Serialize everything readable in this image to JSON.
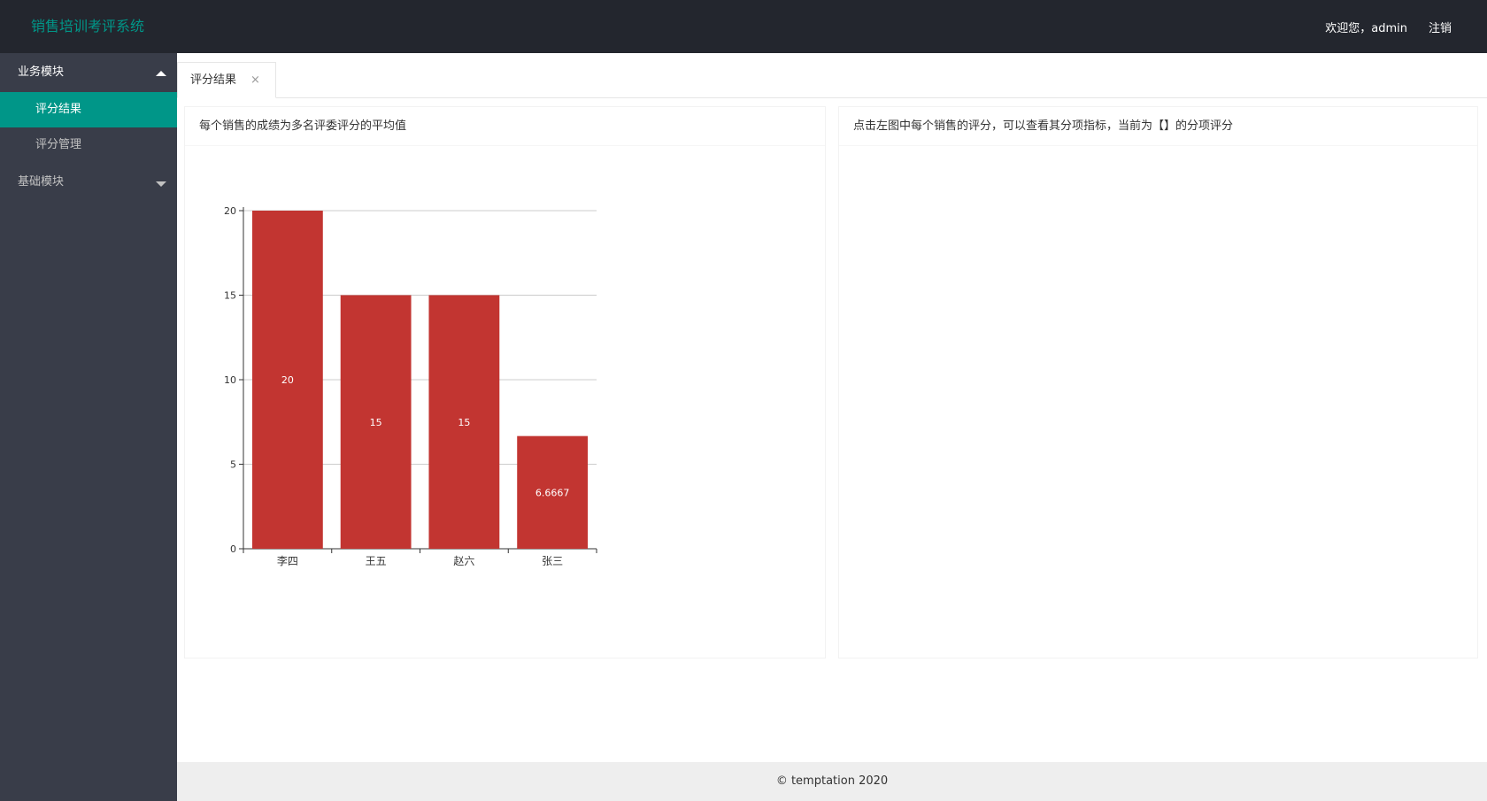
{
  "header": {
    "logo": "销售培训考评系统",
    "welcome": "欢迎您，admin",
    "logout": "注销"
  },
  "sidebar": {
    "groups": [
      {
        "label": "业务模块",
        "expanded": true,
        "items": [
          {
            "label": "评分结果",
            "active": true
          },
          {
            "label": "评分管理",
            "active": false
          }
        ]
      },
      {
        "label": "基础模块",
        "expanded": false,
        "items": []
      }
    ]
  },
  "tabs": [
    {
      "label": "评分结果",
      "close": "×"
    }
  ],
  "cards": {
    "left_title": "每个销售的成绩为多名评委评分的平均值",
    "right_title": "点击左图中每个销售的评分，可以查看其分项指标，当前为【】的分项评分"
  },
  "chart_data": {
    "type": "bar",
    "categories": [
      "李四",
      "王五",
      "赵六",
      "张三"
    ],
    "values": [
      20,
      15,
      15,
      6.6667
    ],
    "value_labels": [
      "20",
      "15",
      "15",
      "6.6667"
    ],
    "yticks": [
      0,
      5,
      10,
      15,
      20
    ],
    "ylim": [
      0,
      20
    ],
    "grid": true,
    "bar_color": "#c23531",
    "title": "",
    "xlabel": "",
    "ylabel": ""
  },
  "footer": {
    "text": "© temptation 2020"
  },
  "colors": {
    "accent": "#009688",
    "header_bg": "#23262e",
    "sidebar_bg": "#393d49"
  }
}
